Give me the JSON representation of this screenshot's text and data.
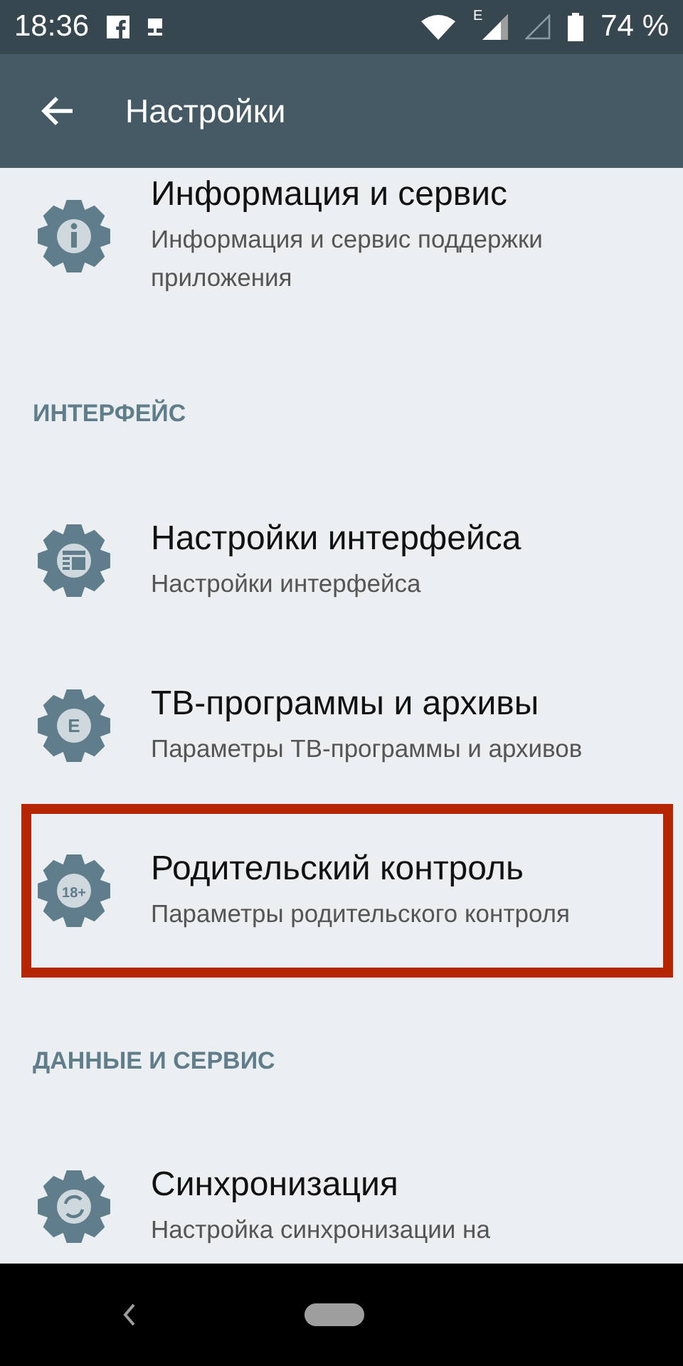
{
  "status_bar": {
    "time": "18:36",
    "network_letter": "E",
    "battery": "74 %"
  },
  "toolbar": {
    "title": "Настройки"
  },
  "sections": [
    {
      "items": [
        {
          "title": "Информация и сервис",
          "subtitle": "Информация и сервис поддержки приложения",
          "kind": "info",
          "highlighted": false
        }
      ]
    },
    {
      "header": "ИНТЕРФЕЙС",
      "items": [
        {
          "title": "Настройки интерфейса",
          "subtitle": "Настройки интерфейса",
          "kind": "layout",
          "highlighted": false
        },
        {
          "title": "ТВ-программы и архивы",
          "subtitle": "Параметры ТВ-программы и архивов",
          "kind": "letter",
          "badge": "E",
          "highlighted": false
        },
        {
          "title": "Родительский контроль",
          "subtitle": "Параметры родительского контроля",
          "kind": "letter",
          "badge": "18+",
          "highlighted": true
        }
      ]
    },
    {
      "header": "ДАННЫЕ И СЕРВИС",
      "items": [
        {
          "title": "Синхронизация",
          "subtitle": "Настройка синхронизации на",
          "kind": "sync",
          "highlighted": false
        }
      ]
    }
  ]
}
